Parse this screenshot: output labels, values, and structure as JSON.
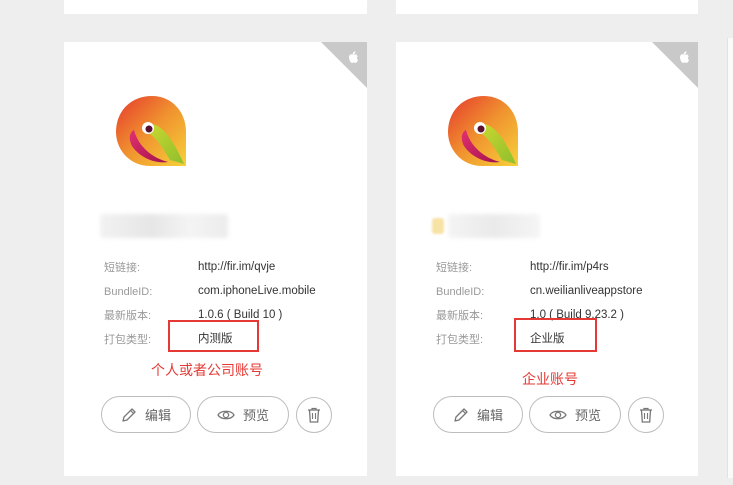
{
  "colors": {
    "highlight": "#e53935",
    "label": "#999999",
    "value": "#333333",
    "border": "#bdbdbd"
  },
  "cards": [
    {
      "platform_icon": "apple-icon",
      "app_icon": "app-logo-icon",
      "short_link_label": "短链接:",
      "short_link": "http://fir.im/qvje",
      "bundle_label": "BundleID:",
      "bundle_id": "com.iphoneLive.mobile",
      "version_label": "最新版本:",
      "version": "1.0.6 ( Build 10 )",
      "type_label": "打包类型:",
      "type": "内测版",
      "note": "个人或者公司账号",
      "edit_label": "编辑",
      "preview_label": "预览"
    },
    {
      "platform_icon": "apple-icon",
      "app_icon": "app-logo-icon",
      "short_link_label": "短链接:",
      "short_link": "http://fir.im/p4rs",
      "bundle_label": "BundleID:",
      "bundle_id": "cn.weilianliveappstore",
      "version_label": "最新版本:",
      "version": "1.0 ( Build 9.23.2 )",
      "type_label": "打包类型:",
      "type": "企业版",
      "note": "企业账号",
      "edit_label": "编辑",
      "preview_label": "预览"
    }
  ]
}
